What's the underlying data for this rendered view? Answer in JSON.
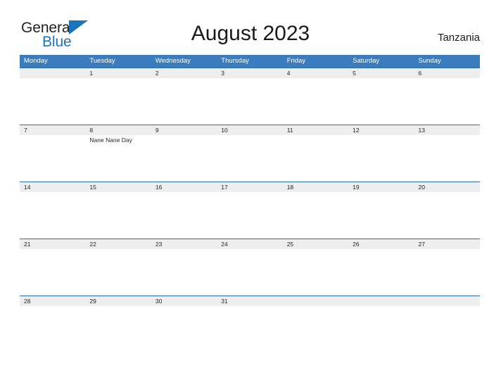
{
  "brand": {
    "name_part1": "General",
    "name_part2": "Blue",
    "flag_icon": "blue-triangle-flag-icon",
    "color_dark": "#231f20",
    "color_blue": "#1b75bb"
  },
  "header": {
    "title": "August 2023",
    "country": "Tanzania"
  },
  "calendar": {
    "header_bg": "#3a7cbe",
    "rule_color": "#2e6da4",
    "date_band_bg": "#eeeeee",
    "weekdays": [
      "Monday",
      "Tuesday",
      "Wednesday",
      "Thursday",
      "Friday",
      "Saturday",
      "Sunday"
    ],
    "weeks": [
      [
        {
          "date": "",
          "events": []
        },
        {
          "date": "1",
          "events": []
        },
        {
          "date": "2",
          "events": []
        },
        {
          "date": "3",
          "events": []
        },
        {
          "date": "4",
          "events": []
        },
        {
          "date": "5",
          "events": []
        },
        {
          "date": "6",
          "events": []
        }
      ],
      [
        {
          "date": "7",
          "events": []
        },
        {
          "date": "8",
          "events": [
            "Nane Nane Day"
          ]
        },
        {
          "date": "9",
          "events": []
        },
        {
          "date": "10",
          "events": []
        },
        {
          "date": "11",
          "events": []
        },
        {
          "date": "12",
          "events": []
        },
        {
          "date": "13",
          "events": []
        }
      ],
      [
        {
          "date": "14",
          "events": []
        },
        {
          "date": "15",
          "events": []
        },
        {
          "date": "16",
          "events": []
        },
        {
          "date": "17",
          "events": []
        },
        {
          "date": "18",
          "events": []
        },
        {
          "date": "19",
          "events": []
        },
        {
          "date": "20",
          "events": []
        }
      ],
      [
        {
          "date": "21",
          "events": []
        },
        {
          "date": "22",
          "events": []
        },
        {
          "date": "23",
          "events": []
        },
        {
          "date": "24",
          "events": []
        },
        {
          "date": "25",
          "events": []
        },
        {
          "date": "26",
          "events": []
        },
        {
          "date": "27",
          "events": []
        }
      ],
      [
        {
          "date": "28",
          "events": []
        },
        {
          "date": "29",
          "events": []
        },
        {
          "date": "30",
          "events": []
        },
        {
          "date": "31",
          "events": []
        },
        {
          "date": "",
          "events": []
        },
        {
          "date": "",
          "events": []
        },
        {
          "date": "",
          "events": []
        }
      ]
    ]
  }
}
